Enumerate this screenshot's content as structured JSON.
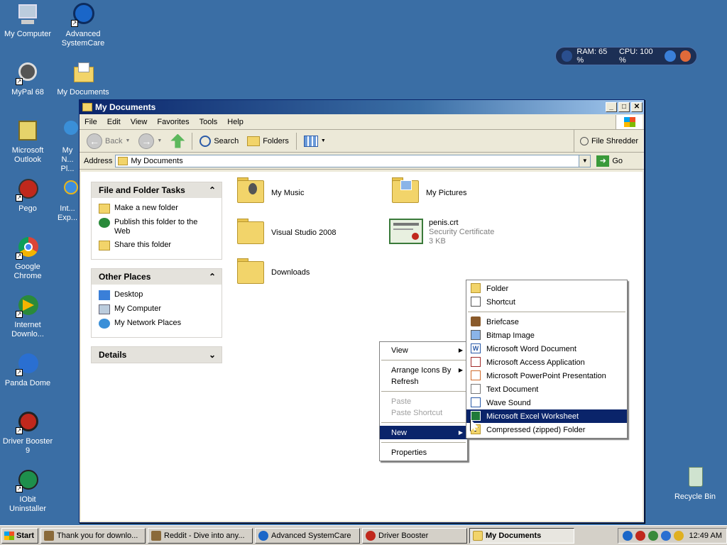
{
  "desktop": {
    "icons_left": [
      "My Computer",
      "MyPal 68",
      "Microsoft Outlook",
      "Pego",
      "Google Chrome",
      "Internet Downlo...",
      "Panda Dome",
      "Driver Booster 9",
      "IObit Uninstaller"
    ],
    "icons_col2": [
      "Advanced SystemCare",
      "My Documents",
      "My N... Pl...",
      "Int... Exp..."
    ],
    "recycle_bin": "Recycle Bin"
  },
  "sysmon": {
    "ram": "RAM: 65 %",
    "cpu": "CPU: 100 %"
  },
  "window": {
    "title": "My Documents",
    "menu": [
      "File",
      "Edit",
      "View",
      "Favorites",
      "Tools",
      "Help"
    ],
    "toolbar": {
      "back": "Back",
      "search": "Search",
      "folders": "Folders",
      "file_shredder": "File Shredder"
    },
    "address": {
      "label": "Address",
      "value": "My Documents",
      "go": "Go"
    },
    "tasks": {
      "file_folder": {
        "title": "File and Folder Tasks",
        "items": [
          "Make a new folder",
          "Publish this folder to the Web",
          "Share this folder"
        ]
      },
      "other_places": {
        "title": "Other Places",
        "items": [
          "Desktop",
          "My Computer",
          "My Network Places"
        ]
      },
      "details": {
        "title": "Details"
      }
    },
    "items": [
      {
        "name": "My Music"
      },
      {
        "name": "My Pictures"
      },
      {
        "name": "Visual Studio 2008"
      },
      {
        "name": "penis.crt",
        "type": "Security Certificate",
        "size": "3 KB"
      },
      {
        "name": "Downloads"
      }
    ]
  },
  "context_menu": {
    "items": [
      "View",
      "Arrange Icons By",
      "Refresh",
      "Paste",
      "Paste Shortcut",
      "New",
      "Properties"
    ]
  },
  "new_submenu": {
    "items": [
      "Folder",
      "Shortcut",
      "Briefcase",
      "Bitmap Image",
      "Microsoft Word Document",
      "Microsoft Access Application",
      "Microsoft PowerPoint Presentation",
      "Text Document",
      "Wave Sound",
      "Microsoft Excel Worksheet",
      "Compressed (zipped) Folder"
    ]
  },
  "taskbar": {
    "start": "Start",
    "tasks": [
      "Thank you for downlo...",
      "Reddit - Dive into any...",
      "Advanced SystemCare",
      "Driver Booster",
      "My Documents"
    ],
    "clock": "12:49 AM"
  },
  "colors": {
    "desktop": "#3a6ea5",
    "selection": "#0a246a"
  }
}
